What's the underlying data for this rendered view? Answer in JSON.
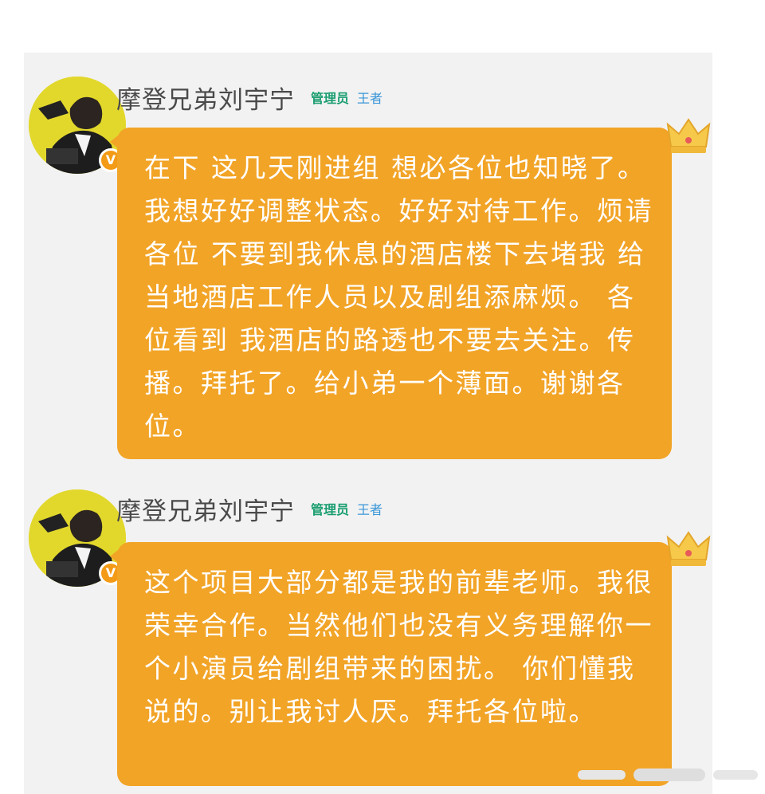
{
  "messages": [
    {
      "username": "摩登兄弟刘宇宁",
      "role_tag": "管理员",
      "rank_tag": "王者",
      "text": "在下 这几天刚进组 想必各位也知晓了。 我想好好调整状态。好好对待工作。烦请各位 不要到我休息的酒店楼下去堵我 给当地酒店工作人员以及剧组添麻烦。 各位看到 我酒店的路透也不要去关注。传播。拜托了。给小弟一个薄面。谢谢各位。"
    },
    {
      "username": "摩登兄弟刘宇宁",
      "role_tag": "管理员",
      "rank_tag": "王者",
      "text": "这个项目大部分都是我的前辈老师。我很荣幸合作。当然他们也没有义务理解你一个小演员给剧组带来的困扰。 你们懂我说的。别让我讨人厌。拜托各位啦。"
    }
  ],
  "verified_badge": "V",
  "colors": {
    "bubble": "#f2a427",
    "role_tag": "#1a9e70",
    "rank_tag": "#3a96d8",
    "username": "#4a4a4a",
    "avatar_bg": "#e2d82c",
    "verified_badge": "#f39a16"
  },
  "icons": {
    "avatar": "avatar-photo",
    "badge": "verified-badge-icon",
    "crown": "crown-icon"
  }
}
